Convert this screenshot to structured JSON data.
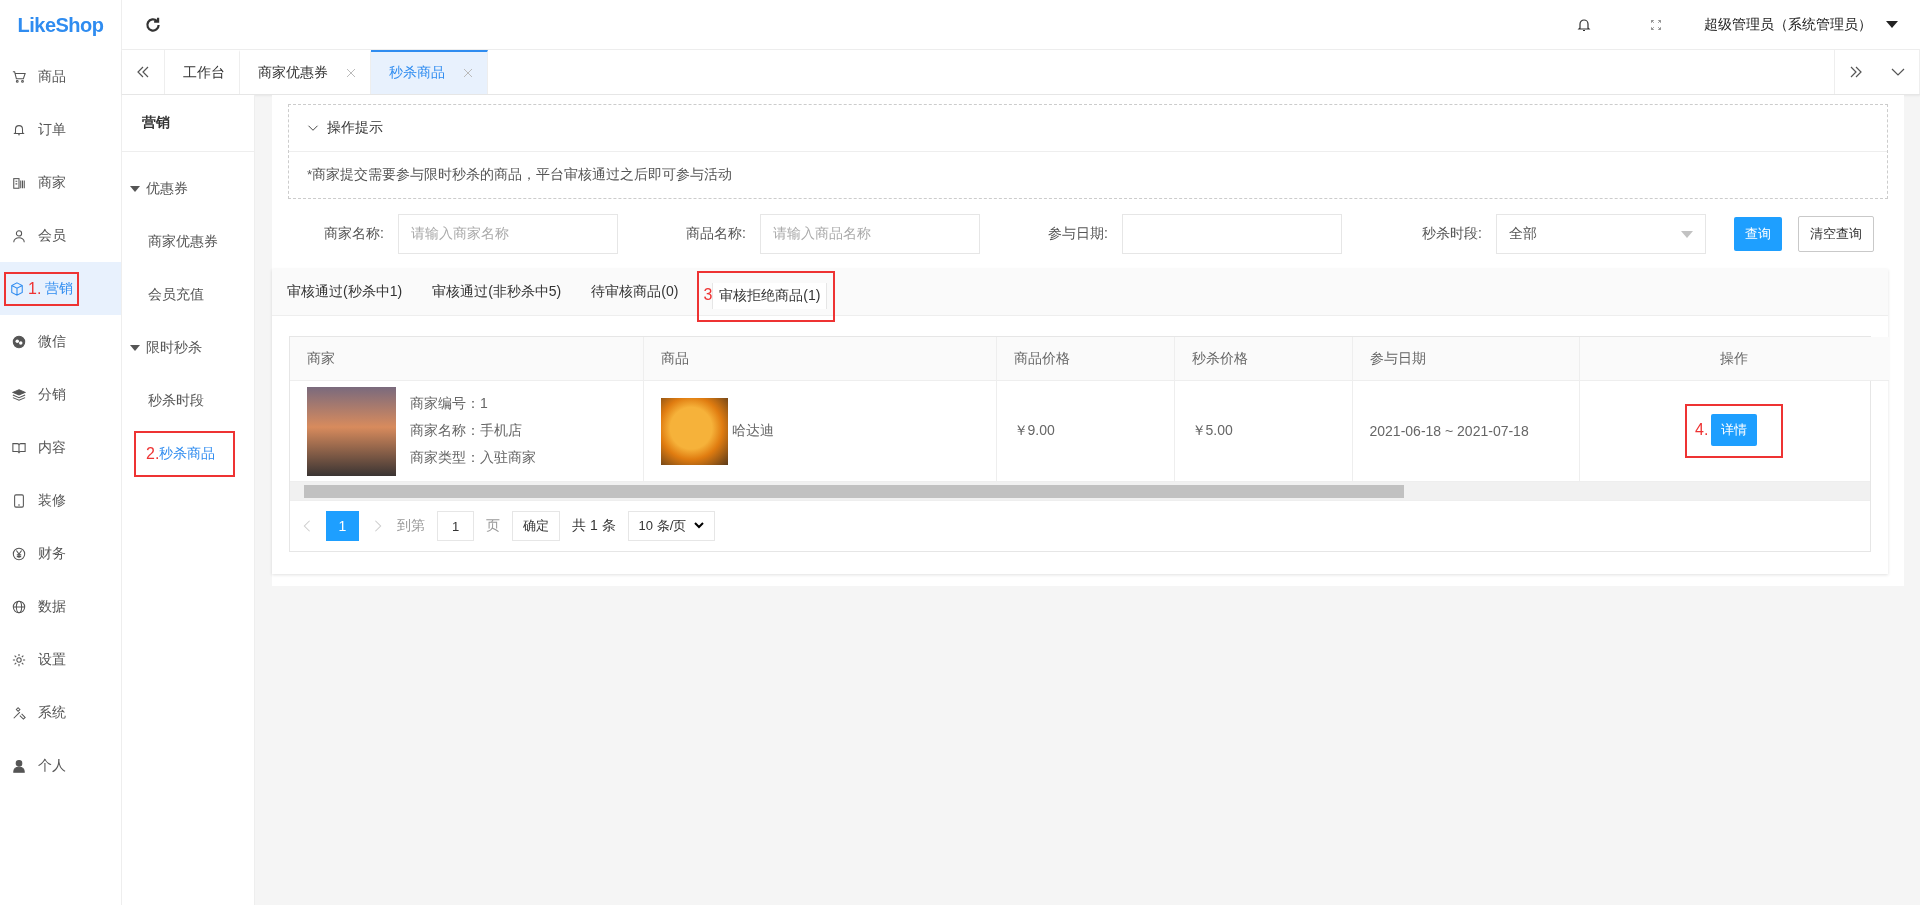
{
  "logo": "LikeShop",
  "sidebar": {
    "items": [
      {
        "label": "商品",
        "selected": false
      },
      {
        "label": "订单",
        "selected": false
      },
      {
        "label": "商家",
        "selected": false
      },
      {
        "label": "会员",
        "selected": false
      },
      {
        "label": "营销",
        "selected": true,
        "annotation": "1."
      },
      {
        "label": "微信",
        "selected": false
      },
      {
        "label": "分销",
        "selected": false
      },
      {
        "label": "内容",
        "selected": false
      },
      {
        "label": "装修",
        "selected": false
      },
      {
        "label": "财务",
        "selected": false
      },
      {
        "label": "数据",
        "selected": false
      },
      {
        "label": "设置",
        "selected": false
      },
      {
        "label": "系统",
        "selected": false
      },
      {
        "label": "个人",
        "selected": false
      }
    ]
  },
  "topbar": {
    "user": "超级管理员（系统管理员）"
  },
  "page_tabs": [
    {
      "label": "工作台",
      "selected": false,
      "closable": false
    },
    {
      "label": "商家优惠券",
      "selected": false,
      "closable": true
    },
    {
      "label": "秒杀商品",
      "selected": true,
      "closable": true
    }
  ],
  "submenu": {
    "title": "营销",
    "groups": [
      {
        "label": "优惠券",
        "expanded": true,
        "children": [
          {
            "label": "商家优惠券",
            "selected": false
          },
          {
            "label": "会员充值",
            "selected": false
          }
        ]
      },
      {
        "label": "限时秒杀",
        "expanded": true,
        "children": [
          {
            "label": "秒杀时段",
            "selected": false
          },
          {
            "label": "秒杀商品",
            "selected": true,
            "annotation": "2."
          }
        ]
      }
    ]
  },
  "tips": {
    "title": "操作提示",
    "expanded": true,
    "text": "*商家提交需要参与限时秒杀的商品，平台审核通过之后即可参与活动"
  },
  "filters": [
    {
      "kind": "input",
      "label": "商家名称:",
      "placeholder": "请输入商家名称"
    },
    {
      "kind": "input",
      "label": "商品名称:",
      "placeholder": "请输入商品名称"
    },
    {
      "kind": "input",
      "label": "参与日期:"
    },
    {
      "kind": "select",
      "label": "秒杀时段:",
      "value": "全部"
    }
  ],
  "filter_buttons": [
    {
      "kind": "primary",
      "label": "查询"
    },
    {
      "kind": "plain",
      "label": "清空查询"
    }
  ],
  "status_tabs": [
    {
      "label": "审核通过(秒杀中1)",
      "selected": false
    },
    {
      "label": "审核通过(非秒杀中5)",
      "selected": false
    },
    {
      "label": "待审核商品(0)",
      "selected": false
    },
    {
      "label": "审核拒绝商品(1)",
      "selected": true,
      "annotation": "3"
    }
  ],
  "table": {
    "columns": [
      "商家",
      "商品",
      "商品价格",
      "秒杀价格",
      "参与日期",
      "操作"
    ],
    "rows": [
      {
        "shop_info": [
          "商家编号：1",
          "商家名称：手机店",
          "商家类型：入驻商家"
        ],
        "goods_name": "哈达迪",
        "price": "￥9.00",
        "seckill_price": "￥5.00",
        "date": "2021-06-18 ~ 2021-07-18",
        "action": "详情",
        "annotation": "4."
      }
    ]
  },
  "pagination": {
    "pages": [
      {
        "label": "1",
        "selected": true
      }
    ],
    "goto_label": "到第",
    "goto_value": "1",
    "page_unit": "页",
    "confirm": "确定",
    "total": "共 1 条",
    "page_size": "10 条/页"
  }
}
